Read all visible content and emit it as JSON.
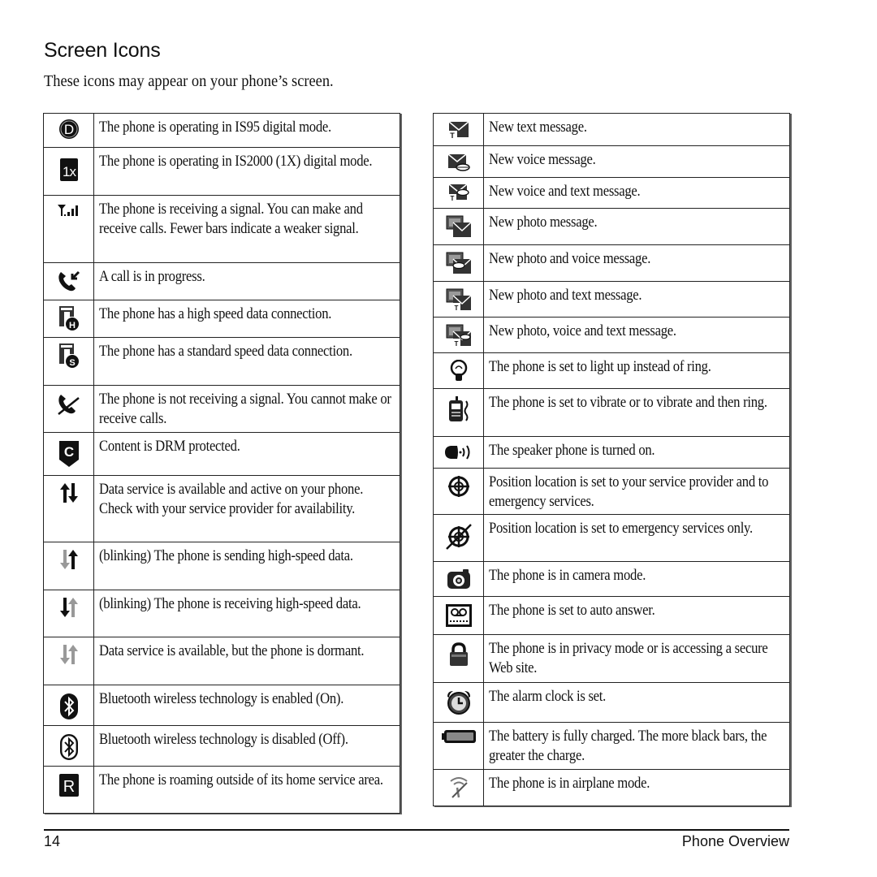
{
  "page": {
    "title": "Screen Icons",
    "intro": "These icons may appear on your phone’s screen.",
    "page_number": "14",
    "section": "Phone Overview"
  },
  "left_table": [
    {
      "icon": "digital-mode-d-icon",
      "text": "The phone is operating in IS95 digital mode."
    },
    {
      "icon": "1x-mode-icon",
      "text": "The phone is operating in IS2000 (1X) digital mode."
    },
    {
      "icon": "signal-strength-icon",
      "text": "The phone is receiving a signal. You can make and receive calls. Fewer bars indicate a weaker signal."
    },
    {
      "icon": "call-in-progress-icon",
      "text": "A call is in progress."
    },
    {
      "icon": "high-speed-data-icon",
      "text": "The phone has a high speed data connection."
    },
    {
      "icon": "standard-speed-data-icon",
      "text": "The phone has a standard speed data connection."
    },
    {
      "icon": "no-signal-icon",
      "text": "The phone is not receiving a signal. You cannot make or receive calls."
    },
    {
      "icon": "drm-protected-icon",
      "text": "Content is DRM protected."
    },
    {
      "icon": "data-active-icon",
      "text": "Data service is available and active on your phone. Check with your service provider for availability."
    },
    {
      "icon": "data-sending-icon",
      "text": "(blinking) The phone is sending high-speed data."
    },
    {
      "icon": "data-receiving-icon",
      "text": "(blinking) The phone is receiving high-speed data."
    },
    {
      "icon": "data-dormant-icon",
      "text": "Data service is available, but the phone is dormant."
    },
    {
      "icon": "bluetooth-on-icon",
      "text": "Bluetooth wireless technology is enabled (On)."
    },
    {
      "icon": "bluetooth-off-icon",
      "text": "Bluetooth wireless technology is disabled (Off)."
    },
    {
      "icon": "roaming-icon",
      "text": "The phone is roaming outside of its home service area."
    }
  ],
  "right_table": [
    {
      "icon": "new-text-message-icon",
      "text": "New text message."
    },
    {
      "icon": "new-voice-message-icon",
      "text": "New voice message."
    },
    {
      "icon": "new-voice-text-message-icon",
      "text": "New voice and text message."
    },
    {
      "icon": "new-photo-message-icon",
      "text": "New photo message."
    },
    {
      "icon": "new-photo-voice-message-icon",
      "text": "New photo and voice message."
    },
    {
      "icon": "new-photo-text-message-icon",
      "text": "New photo and text message."
    },
    {
      "icon": "new-photo-voice-text-message-icon",
      "text": "New photo, voice and text message."
    },
    {
      "icon": "light-up-icon",
      "text": "The phone is set to light up instead of ring."
    },
    {
      "icon": "vibrate-icon",
      "text": "The phone is set to vibrate or to vibrate and then ring."
    },
    {
      "icon": "speakerphone-icon",
      "text": "The speaker phone is turned on."
    },
    {
      "icon": "location-on-icon",
      "text": "Position location is set to your service provider and to emergency services."
    },
    {
      "icon": "location-emergency-only-icon",
      "text": "Position location is set to emergency services only."
    },
    {
      "icon": "camera-mode-icon",
      "text": "The phone is in camera mode."
    },
    {
      "icon": "auto-answer-icon",
      "text": "The phone is set to auto answer."
    },
    {
      "icon": "privacy-lock-icon",
      "text": "The phone is in privacy mode or is accessing a secure Web site."
    },
    {
      "icon": "alarm-clock-icon",
      "text": "The alarm clock is set."
    },
    {
      "icon": "battery-full-icon",
      "text": "The battery is fully charged. The more black bars, the greater the charge."
    },
    {
      "icon": "airplane-mode-icon",
      "text": "The phone is in airplane mode."
    }
  ]
}
